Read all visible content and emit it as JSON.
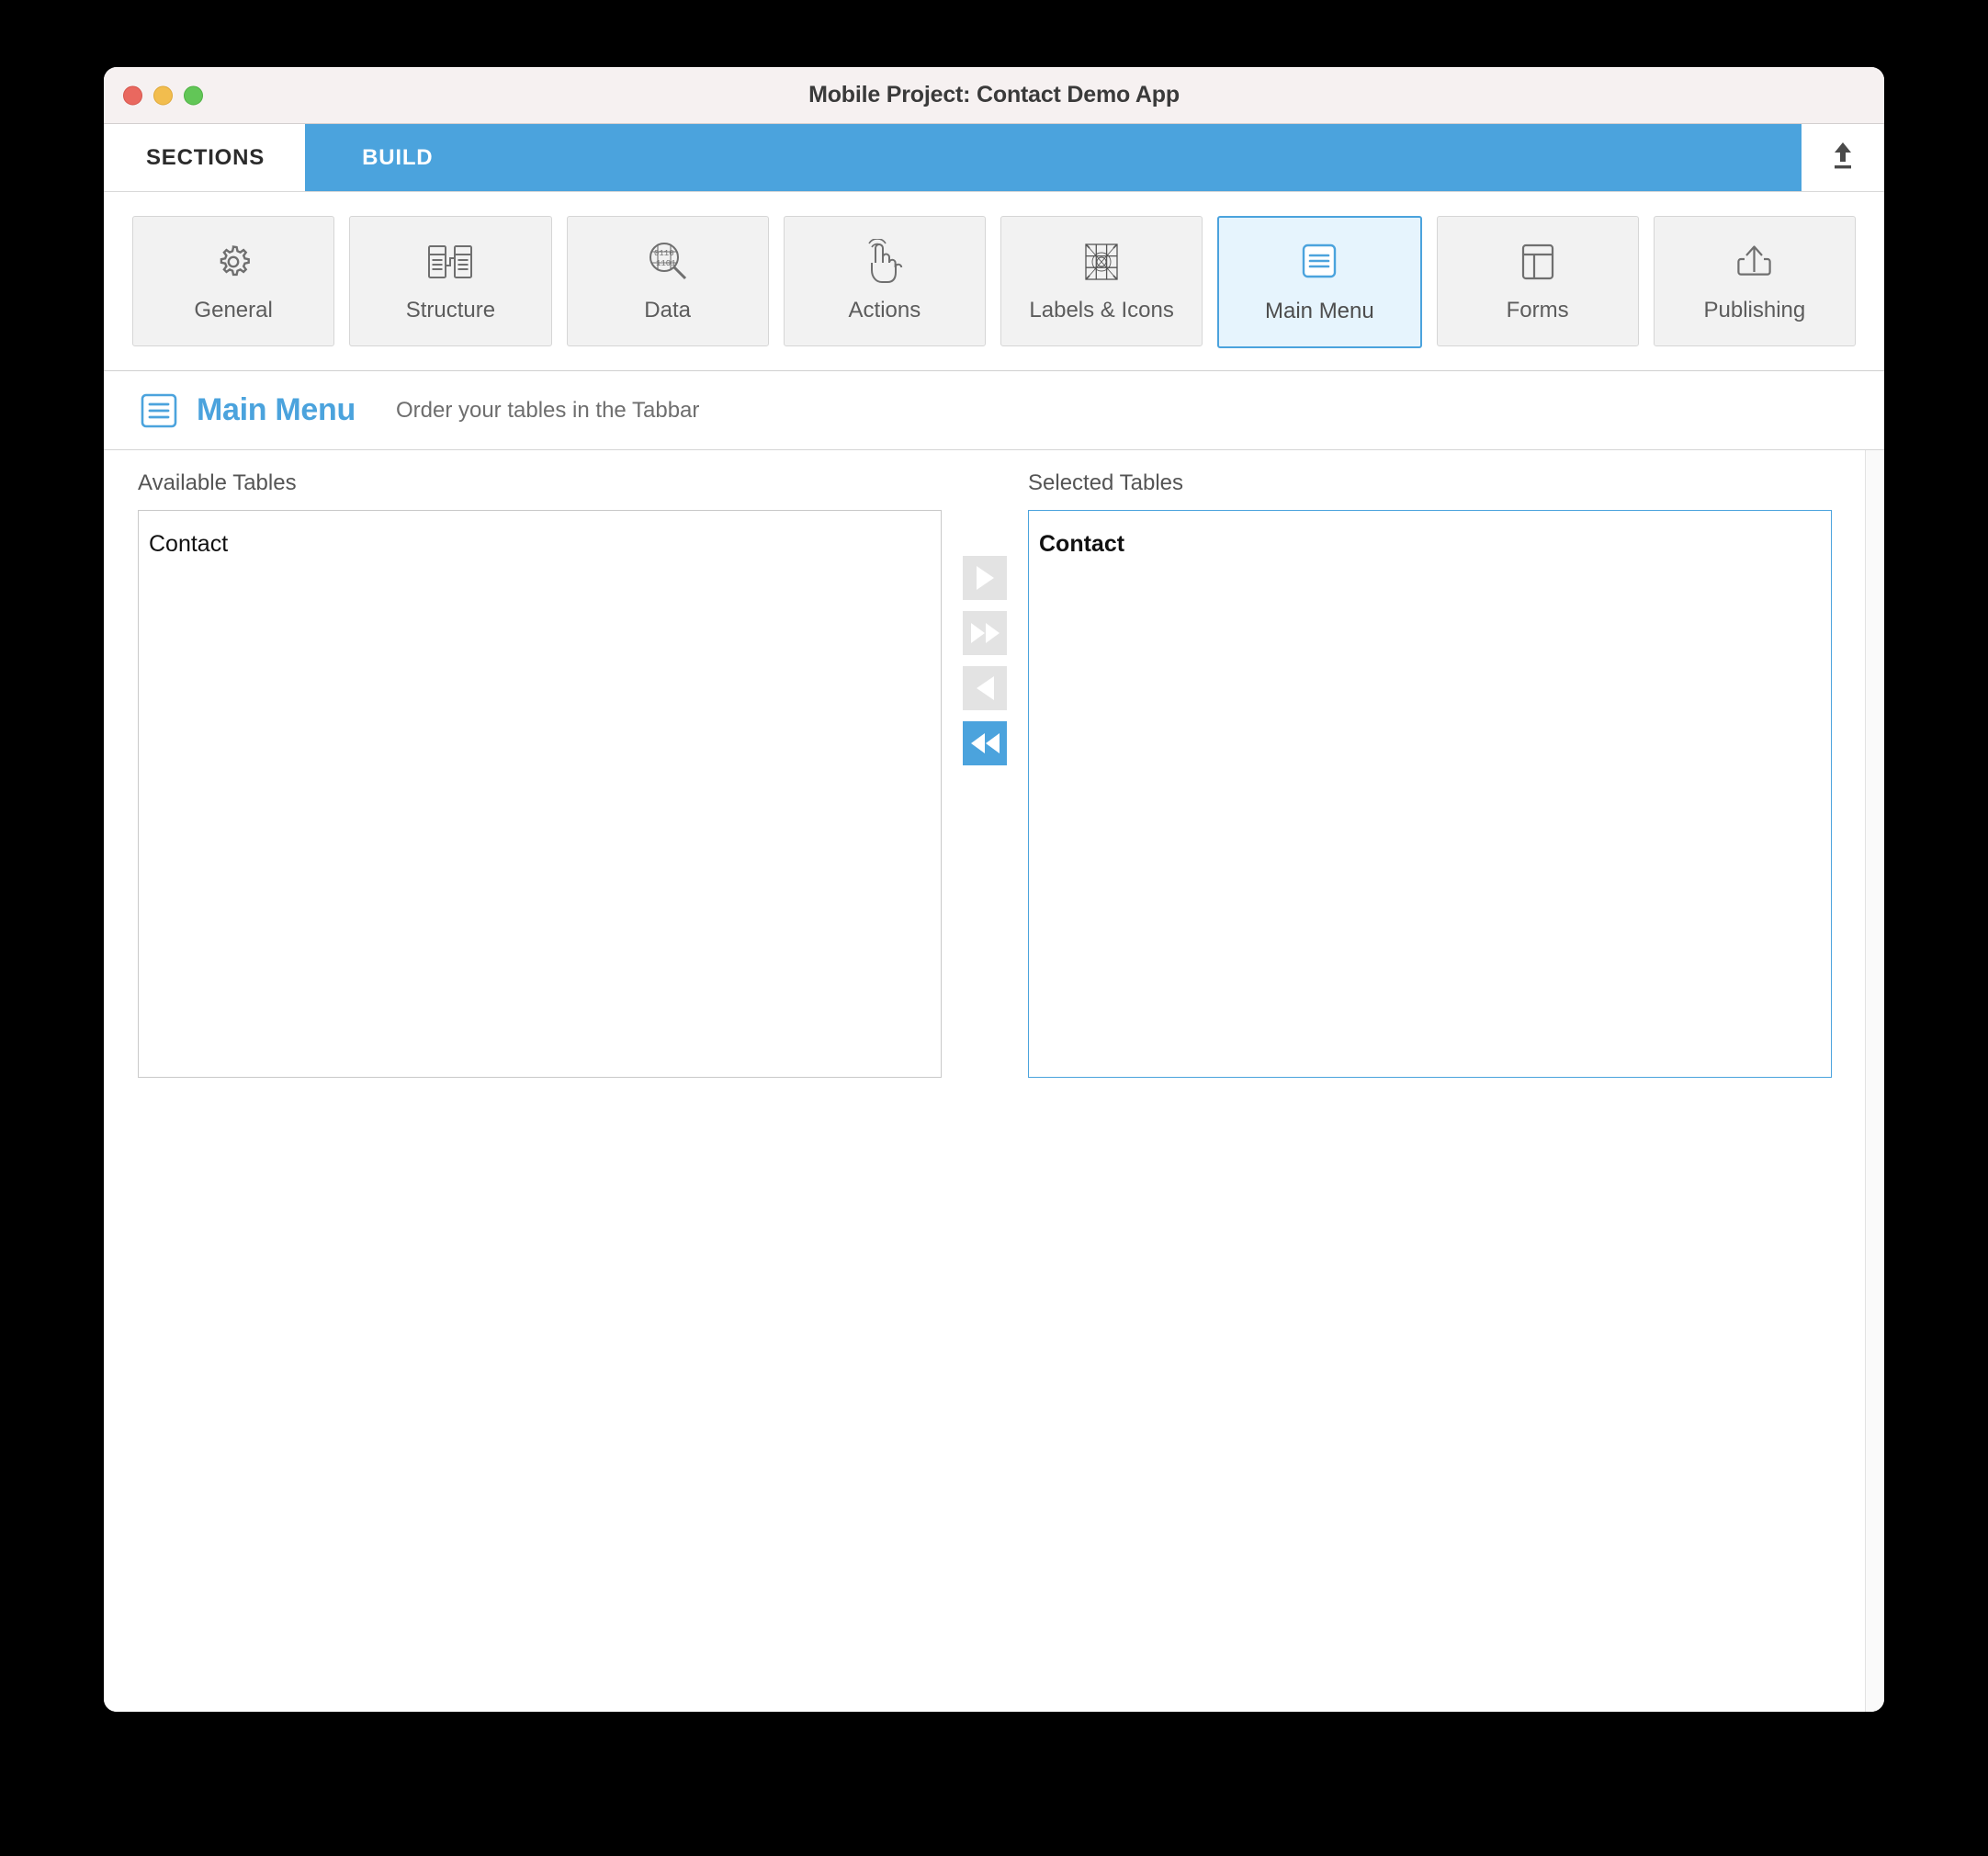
{
  "window": {
    "title": "Mobile Project: Contact Demo App",
    "traffic_lights": [
      "close",
      "minimize",
      "maximize"
    ]
  },
  "tabs": [
    {
      "label": "SECTIONS",
      "active": false
    },
    {
      "label": "BUILD",
      "active": true
    }
  ],
  "tabbar_action": {
    "icon": "upload-icon"
  },
  "toolbar": {
    "items": [
      {
        "label": "General",
        "icon": "gear-icon",
        "selected": false
      },
      {
        "label": "Structure",
        "icon": "structure-icon",
        "selected": false
      },
      {
        "label": "Data",
        "icon": "data-search-icon",
        "selected": false
      },
      {
        "label": "Actions",
        "icon": "tap-hand-icon",
        "selected": false
      },
      {
        "label": "Labels & Icons",
        "icon": "grid-icons-icon",
        "selected": false
      },
      {
        "label": "Main Menu",
        "icon": "menu-list-icon",
        "selected": true
      },
      {
        "label": "Forms",
        "icon": "layout-icon",
        "selected": false
      },
      {
        "label": "Publishing",
        "icon": "upload-box-icon",
        "selected": false
      }
    ]
  },
  "section": {
    "icon": "menu-list-icon",
    "title": "Main Menu",
    "subtitle": "Order your tables in the Tabbar"
  },
  "panels": {
    "available": {
      "label": "Available Tables",
      "focused": false,
      "items": [
        {
          "name": "Contact",
          "bold": false
        }
      ]
    },
    "selected": {
      "label": "Selected Tables",
      "focused": true,
      "items": [
        {
          "name": "Contact",
          "bold": true
        }
      ]
    }
  },
  "transfer_buttons": [
    {
      "name": "move-right-button",
      "direction": "right",
      "enabled": false
    },
    {
      "name": "move-all-right-button",
      "direction": "right-double",
      "enabled": false
    },
    {
      "name": "move-left-button",
      "direction": "left",
      "enabled": false
    },
    {
      "name": "move-all-left-button",
      "direction": "left-double",
      "enabled": true
    }
  ],
  "colors": {
    "accent": "#4ba3dd",
    "titlebar": "#f6f1f1",
    "toolbar_button": "#f2f2f2",
    "selected_button_bg": "#e6f4fd",
    "disabled_button": "#e3e3e3"
  }
}
